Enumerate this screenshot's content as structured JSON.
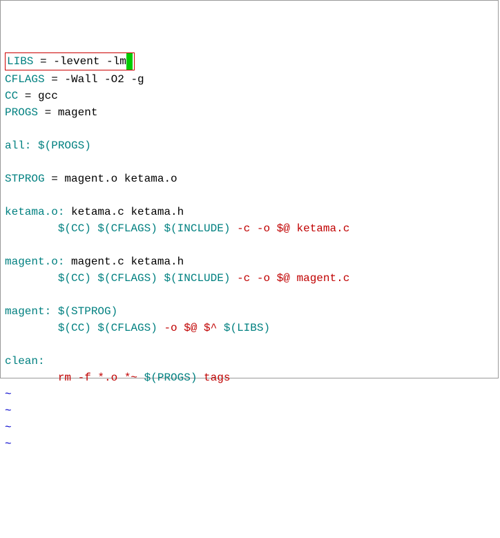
{
  "code": {
    "l1": {
      "var": "LIBS",
      "eq": " = ",
      "val": "-levent -lm"
    },
    "l2": {
      "var": "CFLAGS",
      "eq": " = ",
      "val": "-Wall -O2 -g"
    },
    "l3": {
      "var": "CC",
      "eq": " = ",
      "val": "gcc"
    },
    "l4": {
      "var": "PROGS",
      "eq": " = ",
      "val": "magent"
    },
    "blank1": "",
    "l5": {
      "target": "all:",
      "deps": " $(PROGS)"
    },
    "blank2": "",
    "l6": {
      "var": "STPROG",
      "eq": " = ",
      "val": "magent.o ketama.o"
    },
    "blank3": "",
    "l7": {
      "target": "ketama.o:",
      "deps": " ketama.c ketama.h"
    },
    "l8": {
      "indent": "        ",
      "vars": "$(CC) $(CFLAGS) $(INCLUDE) ",
      "flags": "-c -o $@ ",
      "file": "ketama.c"
    },
    "blank4": "",
    "l9": {
      "target": "magent.o:",
      "deps": " magent.c ketama.h"
    },
    "l10": {
      "indent": "        ",
      "vars": "$(CC) $(CFLAGS) $(INCLUDE) ",
      "flags": "-c -o $@ ",
      "file": "magent.c"
    },
    "blank5": "",
    "l11": {
      "target": "magent:",
      "deps": " $(STPROG)"
    },
    "l12": {
      "indent": "        ",
      "vars1": "$(CC) $(CFLAGS) ",
      "flags": "-o $@ $^ ",
      "vars2": "$(LIBS)"
    },
    "blank6": "",
    "l13": {
      "target": "clean:"
    },
    "l14": {
      "indent": "        ",
      "cmd": "rm -f *.o *~ ",
      "vars": "$(PROGS)",
      "rest": " tags"
    },
    "tilde": "~"
  }
}
